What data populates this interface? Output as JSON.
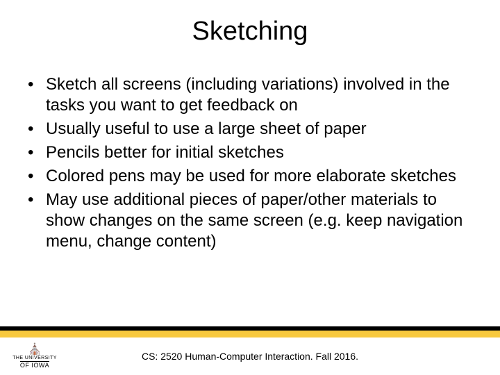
{
  "title": "Sketching",
  "bullets": [
    "Sketch all screens (including variations) involved in the tasks you want to get feedback on",
    "Usually useful to use a large sheet of paper",
    "Pencils better for initial sketches",
    "Colored pens may be used for more elaborate sketches",
    "May use additional pieces of paper/other materials to show changes on the same screen (e.g. keep navigation menu, change content)"
  ],
  "footer": {
    "course": "CS: 2520 Human-Computer Interaction. Fall 2016.",
    "logo_top": "THE UNIVERSITY",
    "logo_bottom": "OF IOWA"
  },
  "colors": {
    "gold": "#f8c93e",
    "black": "#000000"
  }
}
